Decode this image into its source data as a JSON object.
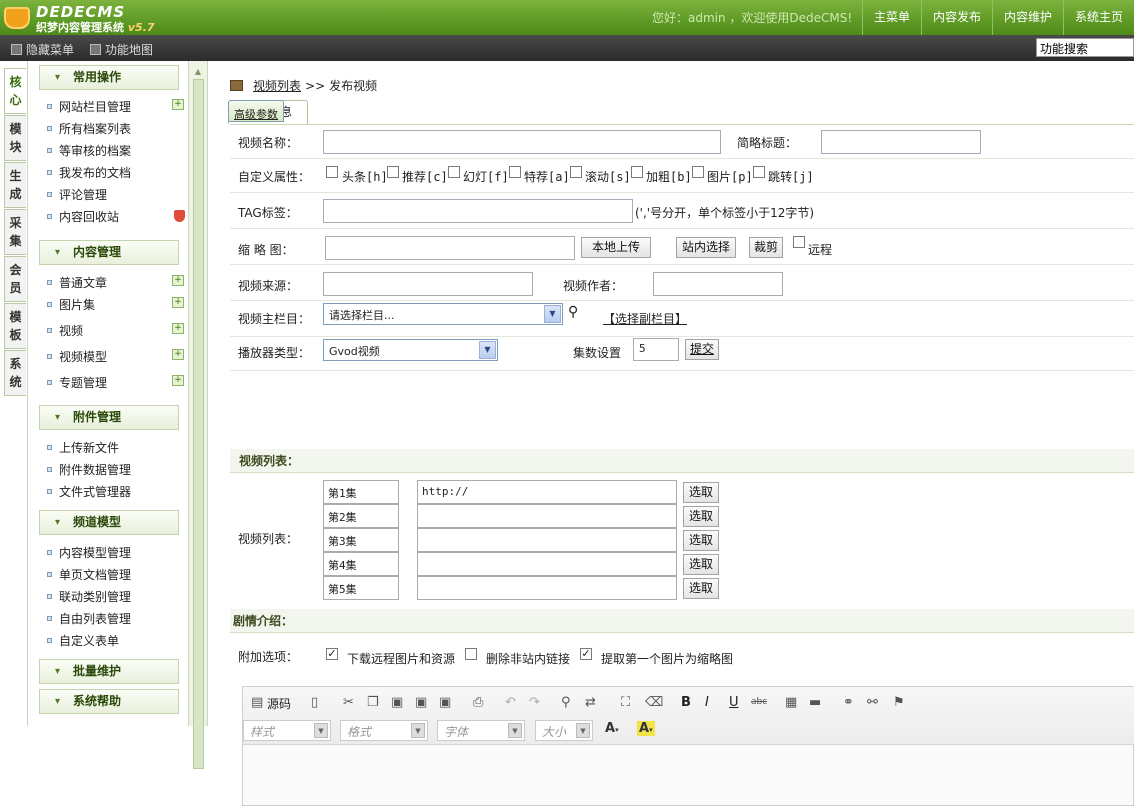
{
  "header": {
    "logo_title": "DEDECMS",
    "logo_subtitle": "织梦内容管理系统",
    "logo_version": "v5.7",
    "welcome": "您好：admin ，欢迎使用DedeCMS!",
    "nav": [
      "主菜单",
      "内容发布",
      "内容维护",
      "系统主页"
    ]
  },
  "subbar": {
    "hide_menu": "隐藏菜单",
    "site_map": "功能地图",
    "search_value": "功能搜索"
  },
  "vtabs": [
    "核心",
    "模块",
    "生成",
    "采集",
    "会员",
    "模板",
    "系统"
  ],
  "sidebar": {
    "groups": [
      {
        "title": "常用操作",
        "items": [
          "网站栏目管理",
          "所有档案列表",
          "等审核的档案",
          "我发布的文档",
          "评论管理",
          "内容回收站"
        ]
      },
      {
        "title": "内容管理",
        "items": [
          "普通文章",
          "图片集",
          "视频",
          "视频模型",
          "专题管理"
        ]
      },
      {
        "title": "附件管理",
        "items": [
          "上传新文件",
          "附件数据管理",
          "文件式管理器"
        ]
      },
      {
        "title": "频道模型",
        "items": [
          "内容模型管理",
          "单页文档管理",
          "联动类别管理",
          "自由列表管理",
          "自定义表单"
        ]
      },
      {
        "title": "批量维护",
        "items": []
      },
      {
        "title": "系统帮助",
        "items": []
      }
    ]
  },
  "breadcrumb": {
    "link": "视频列表",
    "sep": ">>",
    "current": "发布视频"
  },
  "tabs": [
    "常规信息",
    "高级参数"
  ],
  "form": {
    "title_label": "视频名称：",
    "short_title_label": "简略标题：",
    "attr_label": "自定义属性：",
    "attrs": [
      "头条[h]",
      "推荐[c]",
      "幻灯[f]",
      "特荐[a]",
      "滚动[s]",
      "加粗[b]",
      "图片[p]",
      "跳转[j]"
    ],
    "tag_label": "TAG标签：",
    "tag_hint": "(','号分开，单个标签小于12字节)",
    "thumb_label": "缩 略 图：",
    "upload_btn": "本地上传",
    "site_select_btn": "站内选择",
    "crop_btn": "裁剪",
    "remote_label": "远程",
    "source_label": "视频来源：",
    "author_label": "视频作者：",
    "column_label": "视频主栏目：",
    "column_value": "请选择栏目...",
    "sub_column_link": "【选择副栏目】",
    "player_label": "播放器类型：",
    "player_value": "Gvod视频",
    "episodes_label": "集数设置",
    "episodes_value": "5",
    "submit_btn": "提交",
    "video_list_section": "视频列表：",
    "video_list_label": "视频列表：",
    "episodes": [
      {
        "name": "第1集",
        "url": "http://",
        "btn": "选取"
      },
      {
        "name": "第2集",
        "url": "",
        "btn": "选取"
      },
      {
        "name": "第3集",
        "url": "",
        "btn": "选取"
      },
      {
        "name": "第4集",
        "url": "",
        "btn": "选取"
      },
      {
        "name": "第5集",
        "url": "",
        "btn": "选取"
      }
    ],
    "intro_section": "剧情介绍：",
    "extra_label": "附加选项：",
    "extra_options": [
      "下载远程图片和资源",
      "删除非站内链接",
      "提取第一个图片为缩略图"
    ],
    "extra_checked": [
      true,
      false,
      true
    ]
  },
  "editor": {
    "source_btn": "源码",
    "combos": [
      "样式",
      "格式",
      "字体",
      "大小"
    ]
  }
}
